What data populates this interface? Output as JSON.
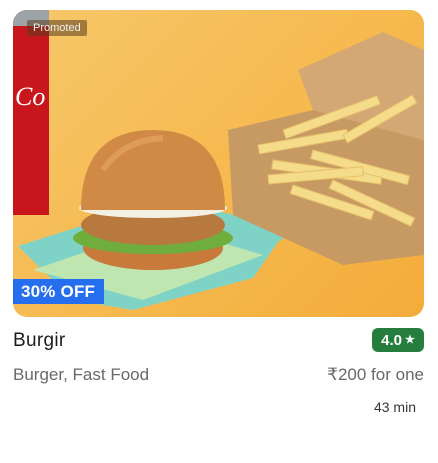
{
  "restaurant": {
    "promoted_label": "Promoted",
    "discount_label": "30% OFF",
    "name": "Burgir",
    "rating": "4.0",
    "rating_icon": "star-icon",
    "cuisine": "Burger, Fast Food",
    "price": "₹200 for one",
    "delivery_time": "43 min"
  },
  "colors": {
    "rating_bg": "#267e3e",
    "discount_bg": "#256fef",
    "image_bg": "#f6b94e"
  }
}
